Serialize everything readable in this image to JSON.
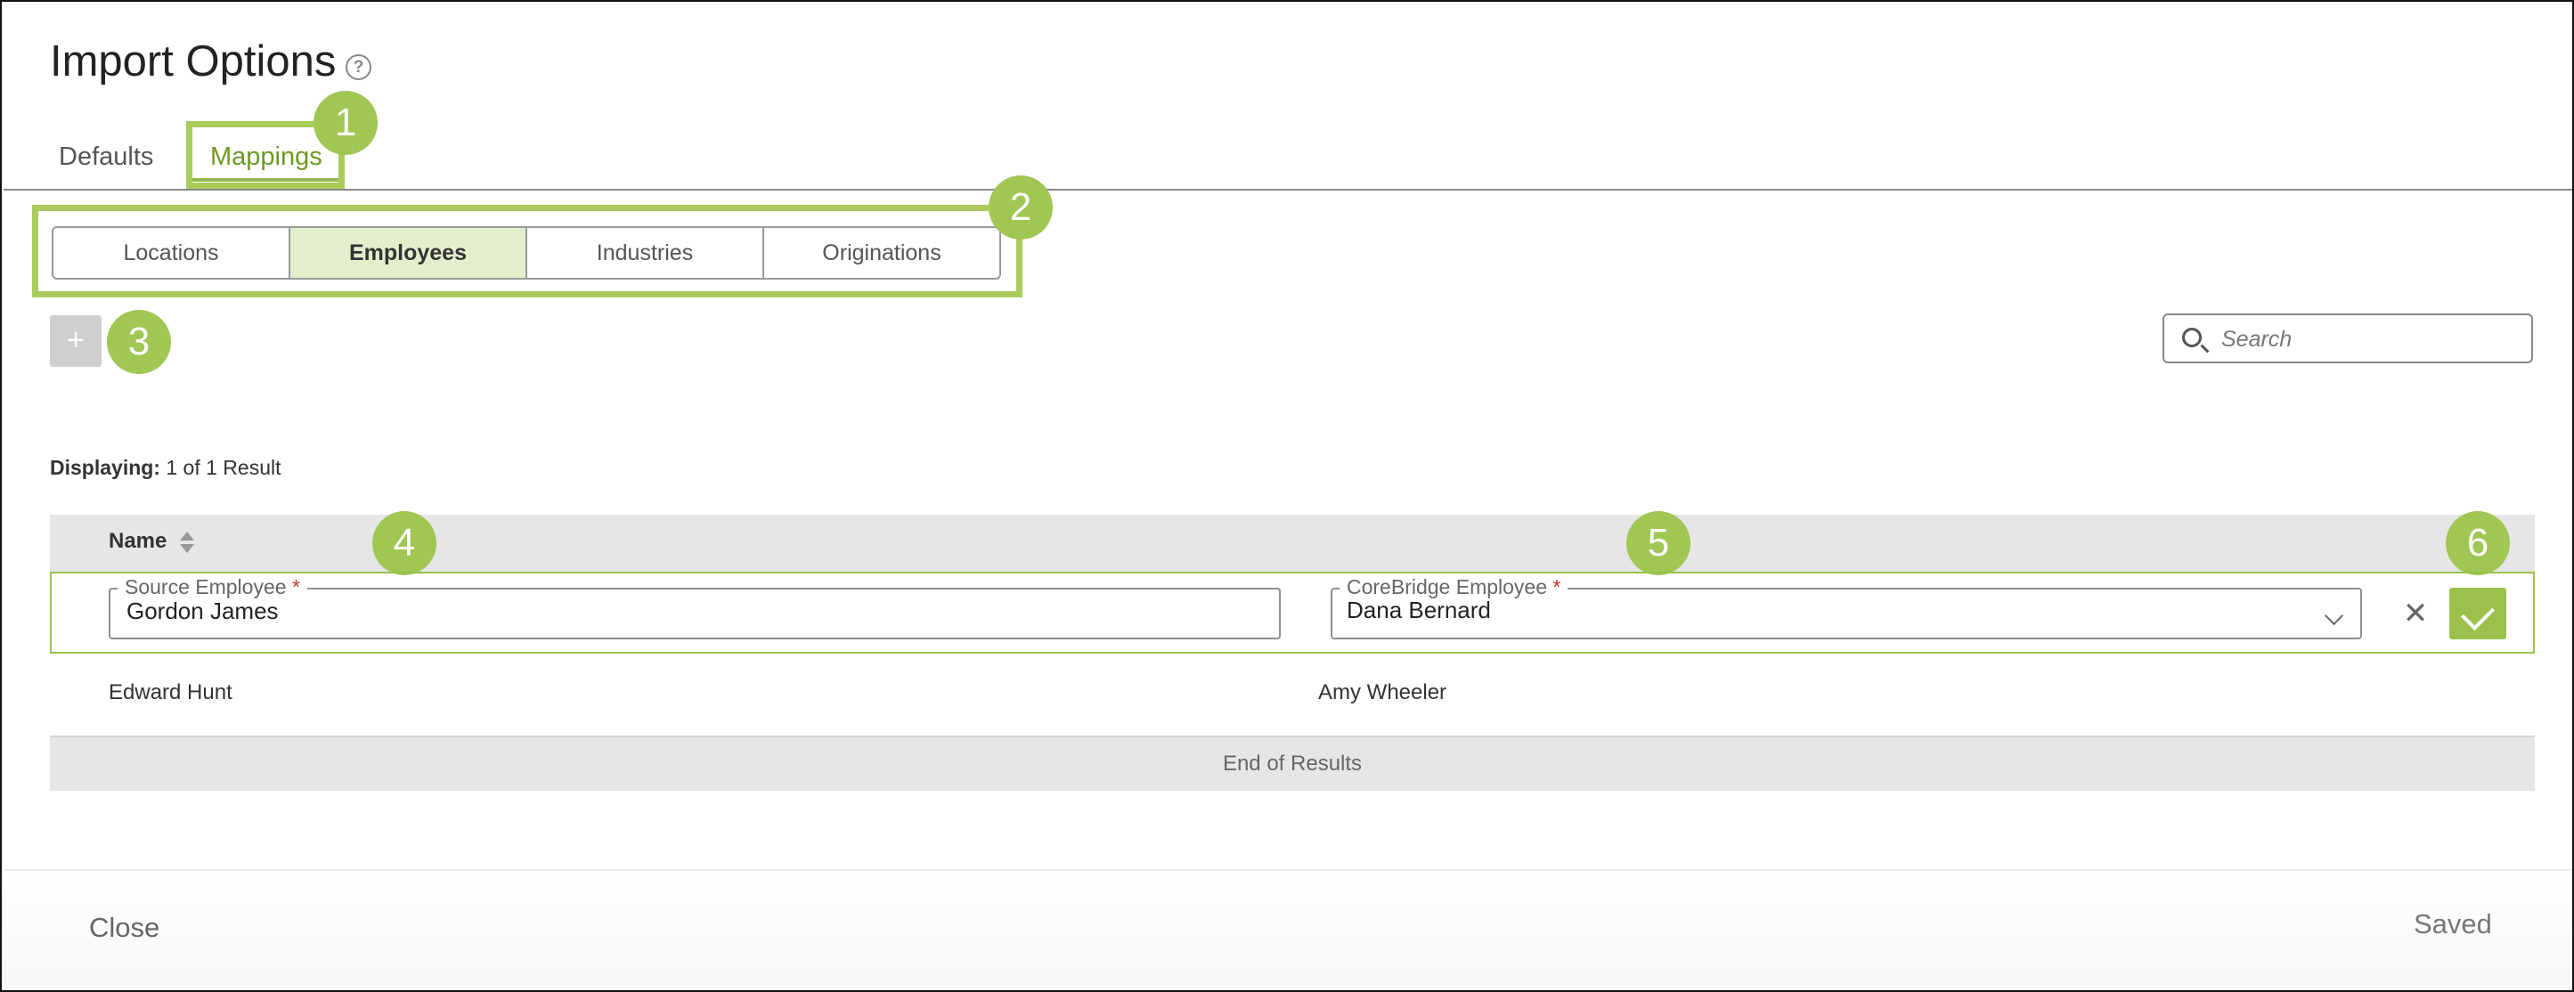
{
  "dialog": {
    "title": "Import Options",
    "help_icon": "?"
  },
  "tabs": [
    {
      "label": "Defaults",
      "active": false
    },
    {
      "label": "Mappings",
      "active": true
    }
  ],
  "subtabs": [
    {
      "label": "Locations",
      "active": false
    },
    {
      "label": "Employees",
      "active": true
    },
    {
      "label": "Industries",
      "active": false
    },
    {
      "label": "Originations",
      "active": false
    }
  ],
  "toolbar": {
    "add_icon": "+",
    "search_placeholder": "Search"
  },
  "results": {
    "label": "Displaying:",
    "summary": "1 of 1 Result"
  },
  "table": {
    "columns": [
      {
        "label": "Name"
      }
    ],
    "edit_row": {
      "source_label": "Source Employee",
      "source_value": "Gordon James",
      "corebridge_label": "CoreBridge Employee",
      "corebridge_value": "Dana Bernard",
      "required_marker": "*",
      "cancel_icon": "✕"
    },
    "rows": [
      {
        "source": "Edward Hunt",
        "corebridge": "Amy Wheeler"
      }
    ],
    "end_label": "End of Results"
  },
  "footer": {
    "close_label": "Close",
    "status": "Saved"
  },
  "annotations": [
    "1",
    "2",
    "3",
    "4",
    "5",
    "6"
  ],
  "colors": {
    "accent": "#a0c653",
    "accent_text": "#6e9a22",
    "active_subtab": "#e3efcc",
    "header_gray": "#e6e6e6"
  }
}
